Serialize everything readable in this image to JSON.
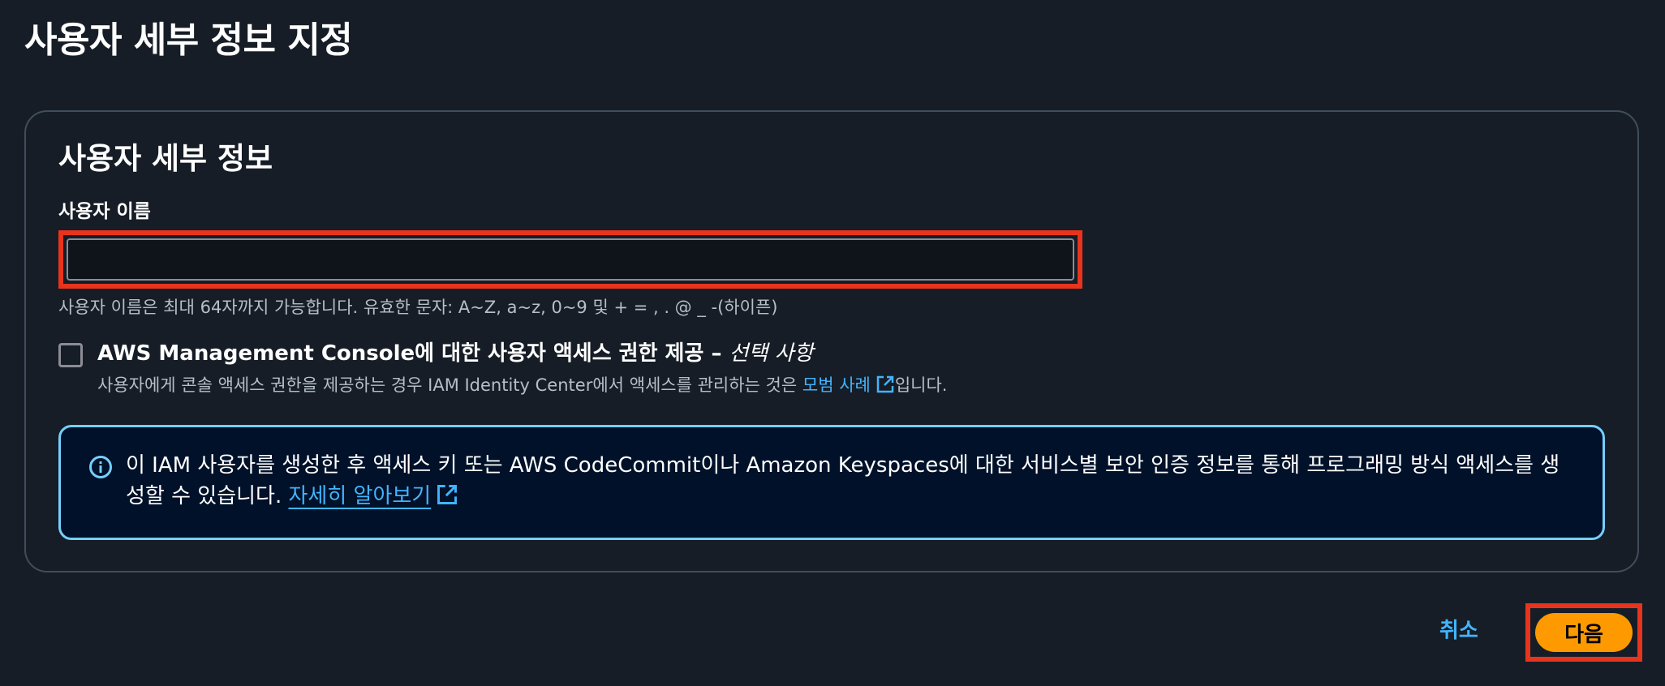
{
  "page": {
    "title": "사용자 세부 정보 지정"
  },
  "details": {
    "section_title": "사용자 세부 정보",
    "username_label": "사용자 이름",
    "username_value": "",
    "username_hint": "사용자 이름은 최대 64자까지 가능합니다. 유효한 문자: A~Z, a~z, 0~9 및 + = , . @ _ -(하이픈)",
    "console_access": {
      "checked": false,
      "label": "AWS Management Console에 대한 사용자 액세스 권한 제공 – ",
      "optional_label": "선택 사항",
      "description_prefix": "사용자에게 콘솔 액세스 권한을 제공하는 경우 IAM Identity Center에서 액세스를 관리하는 것은 ",
      "description_link": "모범 사례",
      "description_suffix": "입니다."
    },
    "info": {
      "icon": "info-icon",
      "text": "이 IAM 사용자를 생성한 후 액세스 키 또는 AWS CodeCommit이나 Amazon Keyspaces에 대한 서비스별 보안 인증 정보를 통해 프로그래밍 방식 액세스를 생성할 수 있습니다. ",
      "link": "자세히 알아보기"
    }
  },
  "footer": {
    "cancel_label": "취소",
    "next_label": "다음"
  },
  "colors": {
    "background": "#161d26",
    "link": "#42b4ff",
    "primary_button": "#ff9900",
    "highlight": "#e8341c",
    "info_border": "#75cfff"
  }
}
